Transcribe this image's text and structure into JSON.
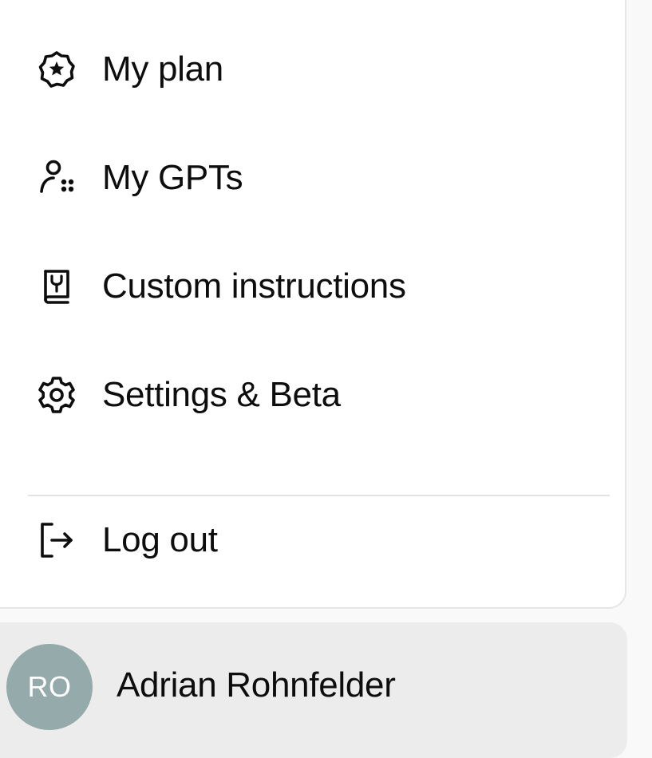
{
  "menu": {
    "items": [
      {
        "label": "My plan",
        "icon": "plan-badge-icon"
      },
      {
        "label": "My GPTs",
        "icon": "gpts-user-icon"
      },
      {
        "label": "Custom instructions",
        "icon": "instructions-book-icon"
      },
      {
        "label": "Settings & Beta",
        "icon": "gear-icon"
      }
    ],
    "logout": {
      "label": "Log out",
      "icon": "log-out-icon"
    }
  },
  "profile": {
    "initials": "RO",
    "name": "Adrian Rohnfelder",
    "avatar_color": "#95aaaa"
  },
  "colors": {
    "panel_background": "#ffffff",
    "profile_background": "#ececec",
    "text": "#0d0d0d",
    "divider": "#e3e3e3"
  }
}
